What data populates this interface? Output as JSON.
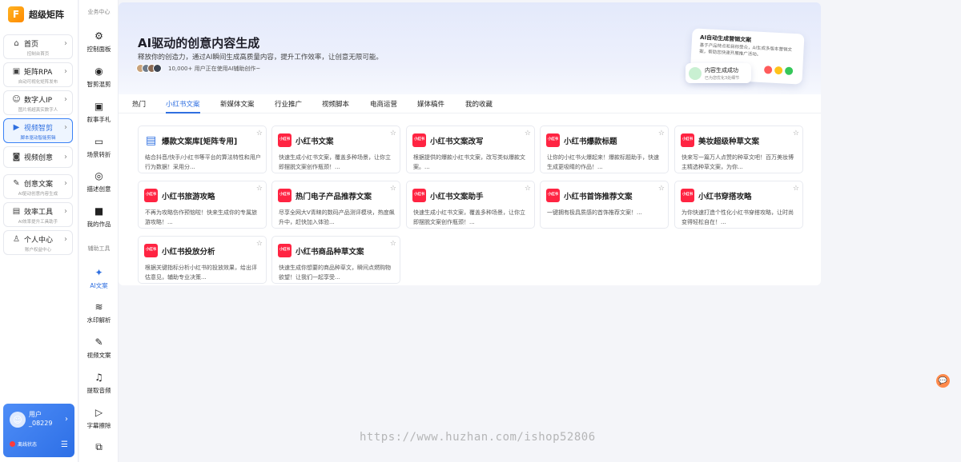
{
  "brand": {
    "name": "超级矩阵",
    "logo_glyph": "F"
  },
  "sidebar": {
    "items": [
      {
        "label": "首页",
        "sub": "控制台首页",
        "icon": "home-icon",
        "active": false
      },
      {
        "label": "矩阵RPA",
        "sub": "自动可视化矩阵发布",
        "icon": "image-icon",
        "active": false
      },
      {
        "label": "数字人IP",
        "sub": "图片将超真实数字人",
        "icon": "robot-icon",
        "active": false
      },
      {
        "label": "视频智剪",
        "sub": "脚本驱动智能剪辑",
        "icon": "video-icon",
        "active": true
      },
      {
        "label": "视频创意",
        "sub": "",
        "icon": "camera-icon",
        "active": false
      },
      {
        "label": "创意文案",
        "sub": "AI驱动创意内容生成",
        "icon": "edit-icon",
        "active": false
      },
      {
        "label": "效率工具",
        "sub": "AI效率提升工具助手",
        "icon": "toolbox-icon",
        "active": false
      },
      {
        "label": "个人中心",
        "sub": "账户权益中心",
        "icon": "user-icon",
        "active": false
      }
    ]
  },
  "user": {
    "name_line1": "用户",
    "name_line2": "_08229",
    "status": "离线状态"
  },
  "tools": {
    "section1": "业务中心",
    "section2": "辅助工具",
    "items": [
      {
        "label": "控制面板",
        "glyph": "⚙"
      },
      {
        "label": "智剪混剪",
        "glyph": "◉"
      },
      {
        "label": "叙事手札",
        "glyph": "▣"
      },
      {
        "label": "场景转折",
        "glyph": "▭"
      },
      {
        "label": "描述创意",
        "glyph": "◎"
      },
      {
        "label": "我的作品",
        "glyph": "■"
      },
      {
        "label": "AI文案",
        "glyph": "✦"
      },
      {
        "label": "水印解析",
        "glyph": "≋"
      },
      {
        "label": "视频文案",
        "glyph": "✎"
      },
      {
        "label": "提取音频",
        "glyph": "♫"
      },
      {
        "label": "字幕擦除",
        "glyph": "▷"
      },
      {
        "label": "",
        "glyph": "⧉"
      }
    ]
  },
  "hero": {
    "title": "AI驱动的创意内容生成",
    "subtitle": "释放你的创造力，通过AI瞬间生成高质量内容，提升工作效率，让创意无限可能。",
    "users_text": "10,000+ 用户正在使用AI辅助创作~"
  },
  "promo": {
    "title": "AI自动生成营销文案",
    "desc": "基于产品特点和目标受众，AI生成多版本营销文案，帮助您快速开展推广活动。",
    "toast_title": "内容生成成功",
    "toast_sub": "已为您优化3处细节",
    "dot_colors": [
      "#ff5b5b",
      "#ffc21a",
      "#35c75a"
    ]
  },
  "tabs": [
    "热门",
    "小红书文案",
    "新媒体文案",
    "行业推广",
    "视频脚本",
    "电商运营",
    "媒体稿件",
    "我的收藏"
  ],
  "active_tab": "小红书文案",
  "cards": [
    {
      "title": "爆款文案库[矩阵专用]",
      "desc": "结合抖音/快手/小红书等平台的算法特性和用户行为数据！采用分...",
      "icon": "doc"
    },
    {
      "title": "小红书文案",
      "desc": "快速生成小红书文案，覆盖多种场景，让你立即摆脱文案创作瓶颈！...",
      "icon": "xhs"
    },
    {
      "title": "小红书文案改写",
      "desc": "根据提供的爆款小红书文案，改写类似爆款文案。...",
      "icon": "xhs"
    },
    {
      "title": "小红书爆款标题",
      "desc": "让你的小红书火爆起来！爆款标题助手，快速生成更吸睛的作品！...",
      "icon": "xhs"
    },
    {
      "title": "美妆超级种草文案",
      "desc": "快来写一篇万人点赞的种草文吧！百万美妆博主精选种草文案，为你...",
      "icon": "xhs"
    },
    {
      "title": "小红书旅游攻略",
      "desc": "不再为攻略伤作预恼啦！快来生成你的专属旅游攻略！...",
      "icon": "xhs"
    },
    {
      "title": "热门电子产品推荐文案",
      "desc": "尽享全网大V青睐的数码产品测评模块，热度飙升中，赶快加入体验...",
      "icon": "xhs"
    },
    {
      "title": "小红书文案助手",
      "desc": "快速生成小红书文案，覆盖多种场景，让你立即摆脱文案创作瓶颈！...",
      "icon": "xhs"
    },
    {
      "title": "小红书首饰推荐文案",
      "desc": "一键拥有极具质感的首饰推荐文案！...",
      "icon": "xhs"
    },
    {
      "title": "小红书穿搭攻略",
      "desc": "为你快速打造个性化小红书穿搭攻略，让时尚变得轻松自在！...",
      "icon": "xhs"
    },
    {
      "title": "小红书投放分析",
      "desc": "根据关键指标分析小红书的投放效果，给出评估意见，辅助专业决策...",
      "icon": "xhs"
    },
    {
      "title": "小红书商品种草文案",
      "desc": "快速生成你想要的商品种草文，瞬间点燃购物欲望！让我们一起享受...",
      "icon": "xhs"
    }
  ],
  "xhs_badge": "小红书",
  "footer_url": "https://www.huzhan.com/ishop52806"
}
